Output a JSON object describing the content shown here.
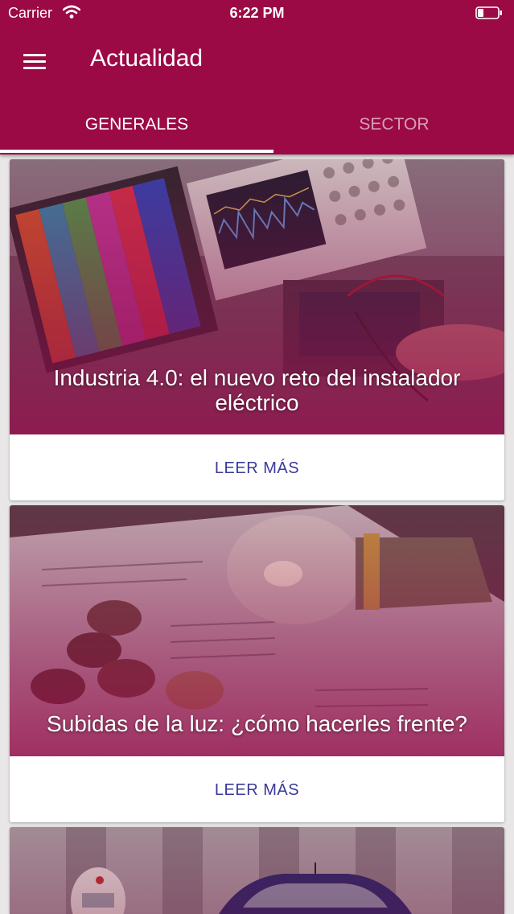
{
  "status_bar": {
    "carrier": "Carrier",
    "time": "6:22 PM",
    "wifi_icon": "wifi-icon",
    "battery_icon": "battery-icon"
  },
  "app_bar": {
    "title": "Actualidad",
    "menu_icon": "hamburger-menu-icon",
    "background_color": "#9b0a45"
  },
  "tabs": [
    {
      "label": "GENERALES",
      "active": true
    },
    {
      "label": "SECTOR",
      "active": false
    }
  ],
  "articles": [
    {
      "title": "Industria 4.0: el nuevo reto del instalador eléctrico",
      "action": "LEER MÁS",
      "image": "oscilloscope-photo"
    },
    {
      "title": "Subidas de la luz: ¿cómo hacerles frente?",
      "action": "LEER MÁS",
      "image": "lightbulb-coins-photo"
    },
    {
      "title": "",
      "action": "",
      "image": "car-charging-photo"
    }
  ],
  "colors": {
    "primary": "#9b0a45",
    "action_text": "#3a3a9a",
    "background": "#e9e6e7"
  }
}
